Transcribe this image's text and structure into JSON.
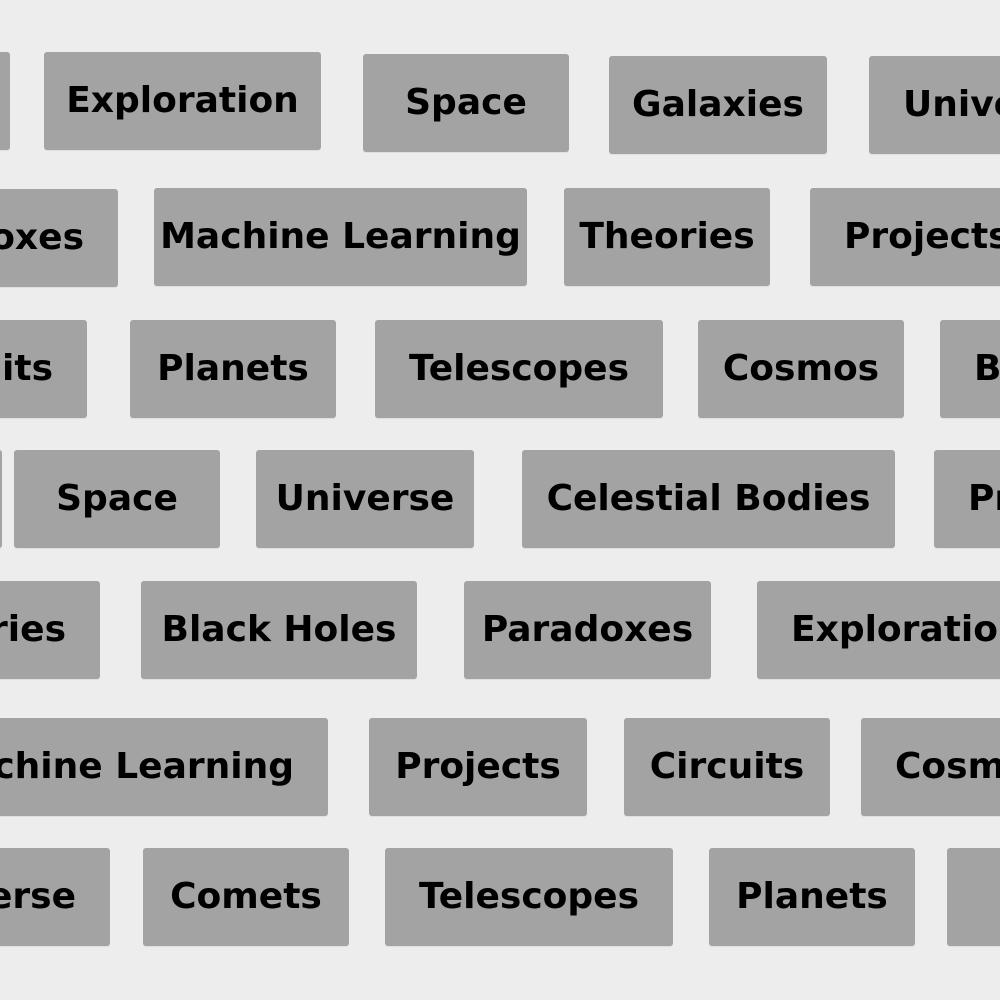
{
  "tags": {
    "row1": [
      "",
      "Exploration",
      "Space",
      "Galaxies",
      "Universe"
    ],
    "row2": [
      "Paradoxes",
      "Machine Learning",
      "Theories",
      "Projects"
    ],
    "row3": [
      "Circuits",
      "Planets",
      "Telescopes",
      "Cosmos",
      "Black Holes"
    ],
    "row4": [
      "",
      "Space",
      "Universe",
      "Celestial Bodies",
      "Projects"
    ],
    "row5": [
      "Theories",
      "Black Holes",
      "Paradoxes",
      "Exploration"
    ],
    "row6": [
      "Machine Learning",
      "Projects",
      "Circuits",
      "Cosmos"
    ],
    "row7": [
      "Universe",
      "Comets",
      "Telescopes",
      "Planets",
      ""
    ]
  }
}
